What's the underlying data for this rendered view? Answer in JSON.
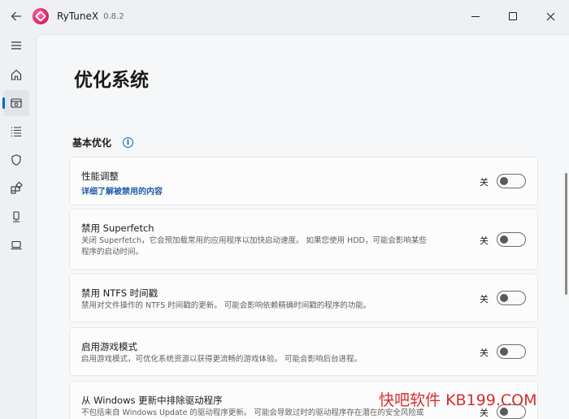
{
  "window": {
    "app_title": "RyTuneX",
    "version": "0.8.2"
  },
  "page": {
    "title": "优化系统"
  },
  "section": {
    "title": "基本优化"
  },
  "cards": [
    {
      "title": "性能调整",
      "link": "详细了解被禁用的内容",
      "toggle_label": "关"
    },
    {
      "title": "禁用 Superfetch",
      "desc_line1": "关闭 Superfetch，它会预加载常用的应用程序以加快启动速度。 如果您使用 HDD，可能会影响某些",
      "desc_line2": "程序的启动时间。",
      "toggle_label": "关"
    },
    {
      "title": "禁用 NTFS 时间戳",
      "desc_line1": "禁用对文件操作的 NTFS 时间戳的更新。 可能会影响依赖精确时间戳的程序的功能。",
      "toggle_label": "关"
    },
    {
      "title": "启用游戏模式",
      "desc_line1": "启用游戏模式，可优化系统资源以获得更流畅的游戏体验。 可能会影响后台进程。",
      "toggle_label": "关"
    },
    {
      "title": "从 Windows 更新中排除驱动程序",
      "desc_line1": "不包括来自 Windows Update 的驱动程序更新。 可能会导致过时的驱动程序存在潜在的安全风险或",
      "toggle_label": "关"
    }
  ],
  "toggles_on": [
    false,
    false,
    false,
    false,
    false
  ],
  "watermark": {
    "cn": "快吧软件",
    "domain": "KB199.COM"
  },
  "colors": {
    "accent": "#0067c0",
    "link": "#1f5aa6",
    "watermark": "#d62d2d"
  }
}
